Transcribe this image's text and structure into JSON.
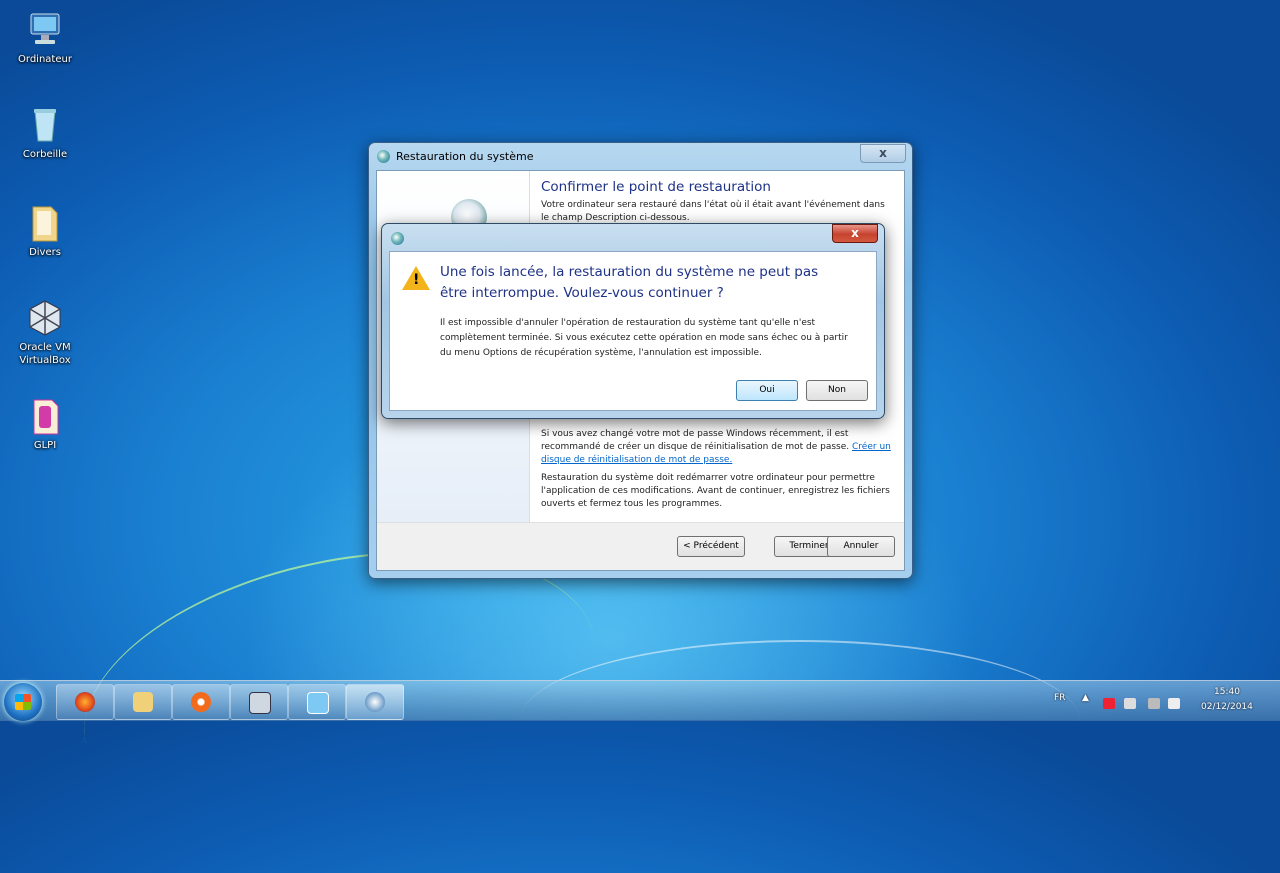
{
  "desktop": {
    "icons": [
      {
        "label": "Ordinateur"
      },
      {
        "label": "Corbeille"
      },
      {
        "label": "Divers"
      },
      {
        "label": "Oracle VM VirtualBox"
      },
      {
        "label": "GLPI"
      }
    ]
  },
  "main_window": {
    "title": "Restauration du système",
    "close_label": "x",
    "heading": "Confirmer le point de restauration",
    "intro": "Votre ordinateur sera restauré dans l'état où il était avant l'événement dans le champ Description ci-dessous.",
    "password_note": "Si vous avez changé votre mot de passe Windows récemment, il est recommandé de créer un disque de réinitialisation de mot de passe.",
    "password_link": "Créer un disque de réinitialisation de mot de passe.",
    "restart_note": "Restauration du système doit redémarrer votre ordinateur pour permettre l'application de ces modifications. Avant de continuer, enregistrez les fichiers ouverts et fermez tous les programmes.",
    "buttons": {
      "back": "< Précédent",
      "finish": "Terminer",
      "cancel": "Annuler"
    }
  },
  "confirm_dialog": {
    "close_label": "x",
    "main_instruction": "Une fois lancée, la restauration du système ne peut pas être interrompue. Voulez-vous continuer ?",
    "body": "Il est impossible d'annuler l'opération de restauration du système tant qu'elle n'est complètement terminée. Si vous exécutez cette opération en mode sans échec ou à partir du menu Options de récupération système, l'annulation est impossible.",
    "warning_glyph": "!",
    "buttons": {
      "yes": "Oui",
      "no": "Non"
    }
  },
  "taskbar": {
    "items": [
      {
        "icon": "firefox-icon"
      },
      {
        "icon": "folder-icon"
      },
      {
        "icon": "media-player-icon"
      },
      {
        "icon": "virtualbox-icon"
      },
      {
        "icon": "monitor-icon"
      },
      {
        "icon": "system-restore-icon"
      }
    ],
    "language": "FR",
    "time": "15:40",
    "date": "02/12/2014"
  }
}
